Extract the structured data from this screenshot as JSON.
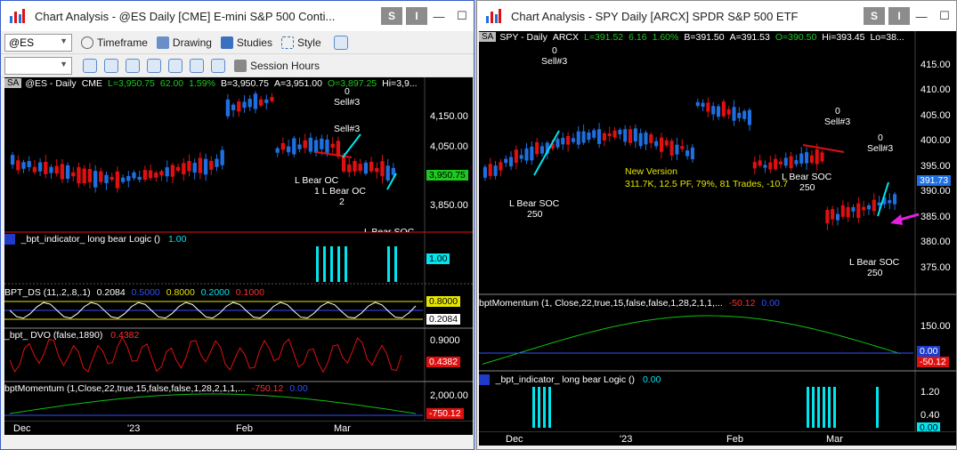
{
  "left": {
    "title": "Chart Analysis - @ES Daily [CME] E-mini S&P 500 Conti...",
    "btn_s": "S",
    "btn_i": "I",
    "win_min": "—",
    "win_max": "☐",
    "symbol": "@ES",
    "toolbar": {
      "timeframe": "Timeframe",
      "drawing": "Drawing",
      "studies": "Studies",
      "style": "Style",
      "session": "Session Hours"
    },
    "header": {
      "sa": "SA",
      "symbol": "@ES - Daily",
      "exch": "CME",
      "last": "L=3,950.75",
      "chg": "62.00",
      "pct": "1.59%",
      "bid": "B=3,950.75",
      "ask": "A=3,951.00",
      "open": "O=3,897.25",
      "high": "Hi=3,9..."
    },
    "price_axis": [
      "4,150.00",
      "4,050.00",
      "3,850.00"
    ],
    "last_tag": "3,950.75",
    "annotations": {
      "sell_zero": "0",
      "sell1": "Sell#3",
      "sell2": "Sell#3",
      "lbear_oc": "L Bear OC",
      "lbear_oc2": "1 L Bear OC",
      "lbear_oc2_n": "2",
      "lbear_soc_partial": "L Bear SOC"
    },
    "ind1": {
      "name": "_bpt_indicator_ long bear Logic ()",
      "value": "1.00",
      "tag": "1.00"
    },
    "ind2": {
      "name": "BPT_DS (11,.2,.8,.1)",
      "v1": "0.2084",
      "v2": "0.5000",
      "v3": "0.8000",
      "v4": "0.2000",
      "v5": "0.1000",
      "tag_top": "0.8000",
      "tag_val": "0.2084"
    },
    "ind3": {
      "name": "_bpt_ DVO (false,1890)",
      "value": "0.4382",
      "axis": "0.9000",
      "tag": "0.4382"
    },
    "ind4": {
      "name": "bptMomentum (1,Close,22,true,15,false,false,1,28,2,1,1,...",
      "v1": "-750.12",
      "v2": "0.00",
      "axis": "2,000.00",
      "tag": "-750.12"
    },
    "dates": [
      "Dec",
      "'23",
      "Feb",
      "Mar"
    ]
  },
  "right": {
    "title": "Chart Analysis - SPY Daily [ARCX] SPDR S&P 500 ETF",
    "btn_s": "S",
    "btn_i": "I",
    "win_min": "—",
    "win_max": "☐",
    "header": {
      "sa": "SA",
      "symbol": "SPY - Daily",
      "exch": "ARCX",
      "last": "L=391.52",
      "chg": "6.16",
      "pct": "1.60%",
      "bid": "B=391.50",
      "ask": "A=391.53",
      "open": "O=390.50",
      "high": "Hi=393.45",
      "low": "Lo=38..."
    },
    "price_axis": [
      "415.00",
      "410.00",
      "405.00",
      "400.00",
      "395.00",
      "390.00",
      "385.00",
      "380.00",
      "375.00"
    ],
    "last_tag": "391.73",
    "annotations": {
      "sell_zero_a": "0",
      "sell_a": "Sell#3",
      "lbear_soc_a": "L Bear SOC",
      "lbear_soc_a_n": "250",
      "new_version": "New Version",
      "stats": "311.7K, 12.5 PF, 79%, 81 Trades, -10.7",
      "lbear_soc_b": "L Bear SOC",
      "lbear_soc_b_n": "250",
      "sell_zero_b": "0",
      "sell_b": "Sell#3",
      "sell_zero_c": "0",
      "sell_c": "Sell#3",
      "lbear_soc_c": "L Bear SOC",
      "lbear_soc_c_n": "250"
    },
    "mom": {
      "name": "bptMomentum (1, Close,22,true,15,false,false,1,28,2,1,1,...",
      "v1": "-50.12",
      "v2": "0.00",
      "axis": "150.00",
      "tag1": "0.00",
      "tag2": "-50.12"
    },
    "ind": {
      "name": "_bpt_indicator_ long bear Logic ()",
      "value": "0.00",
      "axis1": "1.20",
      "axis2": "0.40",
      "tag": "0.00"
    },
    "dates": [
      "Dec",
      "'23",
      "Feb",
      "Mar"
    ]
  },
  "colors": {
    "up": "#1e6fe0",
    "down": "#e01010",
    "cyan": "#00e5ee",
    "yellow": "#e6e600",
    "magenta": "#e020e0",
    "green": "#10c010"
  }
}
